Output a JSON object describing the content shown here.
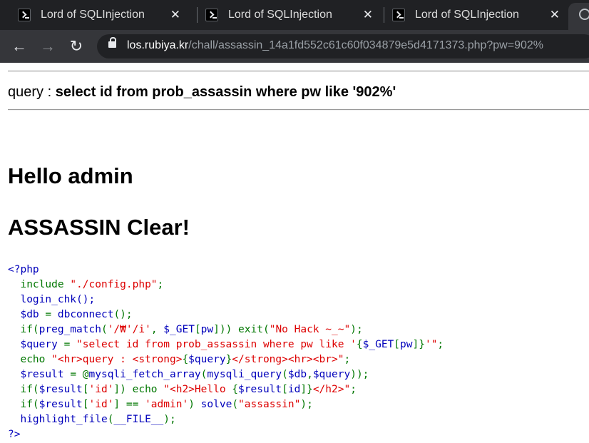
{
  "browser": {
    "tabs": [
      {
        "title": "Lord of SQLInjection"
      },
      {
        "title": "Lord of SQLInjection"
      },
      {
        "title": "Lord of SQLInjection"
      }
    ],
    "url_host": "los.rubiya.kr",
    "url_path": "/chall/assassin_14a1fd552c61c60f034879e5d4171373.php?pw=902%"
  },
  "page": {
    "query_label": "query : ",
    "query_value": "select id from prob_assassin where pw like '902%'",
    "greeting": "Hello admin",
    "clear_message": "ASSASSIN Clear!"
  },
  "source": {
    "l1": "<?php",
    "l2_a": "  include ",
    "l2_b": "\"./config.php\"",
    "l2_c": ";",
    "l3": "  login_chk();",
    "l4_a": "  $db ",
    "l4_b": "= ",
    "l4_c": "dbconnect",
    "l4_d": "();",
    "l5_a": "  if(",
    "l5_b": "preg_match",
    "l5_c": "(",
    "l5_d": "'/₩'/i'",
    "l5_e": ", ",
    "l5_f": "$_GET",
    "l5_g": "[",
    "l5_h": "pw",
    "l5_i": "])) exit(",
    "l5_j": "\"No Hack ~_~\"",
    "l5_k": ");",
    "l6_a": "  $query ",
    "l6_b": "= ",
    "l6_c": "\"select id from prob_assassin where pw like '",
    "l6_d": "{",
    "l6_e": "$_GET",
    "l6_f": "[",
    "l6_g": "pw",
    "l6_h": "]}",
    "l6_i": "'\"",
    "l6_j": ";",
    "l7_a": "  echo ",
    "l7_b": "\"<hr>query : <strong>",
    "l7_c": "{",
    "l7_d": "$query",
    "l7_e": "}",
    "l7_f": "</strong><hr><br>\"",
    "l7_g": ";",
    "l8_a": "  $result ",
    "l8_b": "= @",
    "l8_c": "mysqli_fetch_array",
    "l8_d": "(",
    "l8_e": "mysqli_query",
    "l8_f": "(",
    "l8_g": "$db",
    "l8_h": ",",
    "l8_i": "$query",
    "l8_j": "));",
    "l9_a": "  if(",
    "l9_b": "$result",
    "l9_c": "[",
    "l9_d": "'id'",
    "l9_e": "]) echo ",
    "l9_f": "\"<h2>Hello ",
    "l9_g": "{",
    "l9_h": "$result",
    "l9_i": "[",
    "l9_j": "id",
    "l9_k": "]}",
    "l9_l": "</h2>\"",
    "l9_m": ";",
    "l10_a": "  if(",
    "l10_b": "$result",
    "l10_c": "[",
    "l10_d": "'id'",
    "l10_e": "] == ",
    "l10_f": "'admin'",
    "l10_g": ") ",
    "l10_h": "solve",
    "l10_i": "(",
    "l10_j": "\"assassin\"",
    "l10_k": ");",
    "l11_a": "  highlight_file",
    "l11_b": "(",
    "l11_c": "__FILE__",
    "l11_d": ");",
    "l12": "?>"
  },
  "colors": {
    "tabstrip": "#202124",
    "toolbar": "#35363a",
    "php_default": "#0000bb",
    "php_keyword": "#007700",
    "php_string": "#dd0000"
  }
}
